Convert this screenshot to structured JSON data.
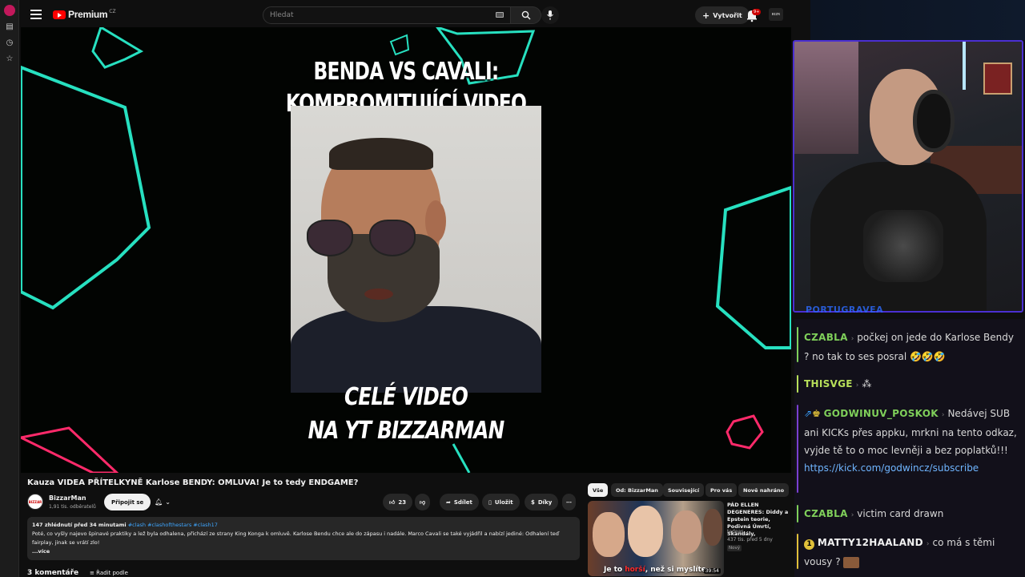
{
  "topbar": {
    "brand": "Premium",
    "brand_region": "CZ",
    "search_placeholder": "Hledat",
    "create_label": "Vytvořit",
    "notif_count": "9+",
    "account_badge": "ʙɪᴢʀ"
  },
  "video": {
    "title_line1": "BENDA VS CAVALI:",
    "title_line2": "KOMPROMITUJÍCÍ VIDEO",
    "cta_line1": "CELÉ VIDEO",
    "cta_line2": "NA YT BIZZARMAN",
    "accent_color": "#27e0c0",
    "accent2_color": "#ff2a6a"
  },
  "watch": {
    "title": "Kauza VIDEA PŘÍTELKYNĚ Karlose BENDY: OMLUVA! Je to tedy ENDGAME?",
    "channel": "BizzarMan",
    "subscribers": "1,91 tis. odběratelů",
    "channel_logo_text": "BIZZAR",
    "join_label": "Připojit se",
    "likes": "23",
    "share_label": "Sdílet",
    "save_label": "Uložit",
    "thanks_label": "Díky",
    "more_label": "⋯",
    "desc_meta": "147 zhlédnutí  před 34 minutami",
    "desc_tags": "#clash #clashofthestars #clash17",
    "desc_text": "Poté, co vyšly najevo špinavé praktiky a lež byla odhalena, přichází ze strany King Konga k omluvě. Karlose Bendu chce ale do zápasu i nadále. Marco Cavali se také vyjádřil a nabízí jediné: Odhalení teď fairplay, jinak se vrátí zlo!",
    "desc_more": "...více",
    "comments_label": "3 komentáře",
    "sort_label": "Řadit podle"
  },
  "recommended": {
    "chips": [
      "Vše",
      "Od: BizzarMan",
      "Související",
      "Pro vás",
      "Nově nahráno"
    ],
    "item": {
      "title": "PÁD ELLEN DEGENERES: Diddy a Epstein teorie, Podivná Úmrtí, Skandály,",
      "channel": "tadeas",
      "meta": "437 tis.  před 5 dny",
      "badge": "Nový",
      "thumb_caption_a": "Je to ",
      "thumb_caption_b": "horší",
      "thumb_caption_c": ", než si myslíte",
      "duration": "39:54"
    }
  },
  "stream": {
    "cam_label": "PORTUGRAVEA",
    "chat": [
      {
        "user": "CZABLA",
        "color": "#7fcf5a",
        "bar": "#7fcf5a",
        "text": "počkej on jede do Karlose Bendy ? no tak to ses posral 🤣🤣🤣"
      },
      {
        "user": "THISVGE",
        "color": "#b8e05a",
        "bar": "#b8e05a",
        "text": "⁂"
      },
      {
        "user": "GODWINUV_POSKOK",
        "color": "#7fcf5a",
        "bar": "#7a3fd1",
        "text": "Nedávej SUB ani KICKs přes appku, mrkni na tento odkaz, vyjde tě to o moc levněji a bez poplatků!!!",
        "link": "https://kick.com/godwincz/subscribe"
      },
      {
        "user": "CZABLA",
        "color": "#7fcf5a",
        "bar": "#7fcf5a",
        "text": "victim card drawn"
      },
      {
        "user": "MATTY12HAALAND",
        "color": "#f1f1f1",
        "bar": "#e0c03a",
        "text": "co má s těmi vousy ?"
      }
    ]
  }
}
